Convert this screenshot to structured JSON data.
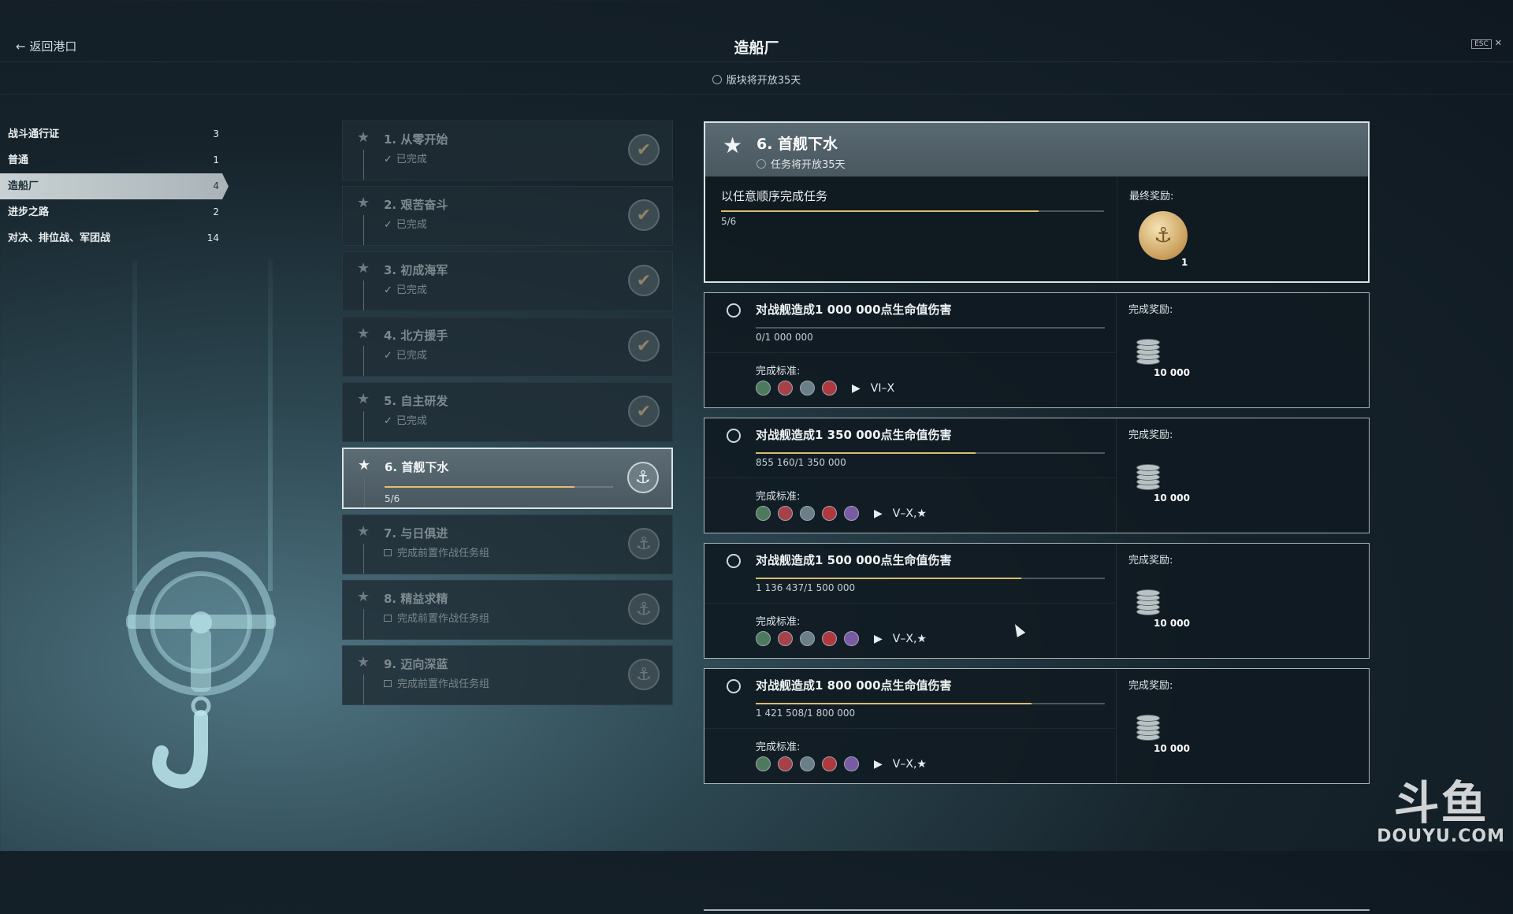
{
  "header": {
    "back_label": "← 返回港口",
    "title": "造船厂",
    "esc_key": "ESC",
    "close": "✕"
  },
  "subheader": {
    "timer": "版块将开放35天"
  },
  "sidebar": {
    "items": [
      {
        "label": "战斗通行证",
        "count": "3"
      },
      {
        "label": "普通",
        "count": "1"
      },
      {
        "label": "造船厂",
        "count": "4",
        "active": true
      },
      {
        "label": "进步之路",
        "count": "2"
      },
      {
        "label": "对决、排位战、军团战",
        "count": "14"
      }
    ]
  },
  "tasks": [
    {
      "name": "1. 从零开始",
      "status": "已完成",
      "state": "done"
    },
    {
      "name": "2. 艰苦奋斗",
      "status": "已完成",
      "state": "done"
    },
    {
      "name": "3. 初成海军",
      "status": "已完成",
      "state": "done"
    },
    {
      "name": "4. 北方援手",
      "status": "已完成",
      "state": "done"
    },
    {
      "name": "5. 自主研发",
      "status": "已完成",
      "state": "done"
    },
    {
      "name": "6. 首舰下水",
      "progress": "5/6",
      "progress_fraction": 0.833,
      "state": "active"
    },
    {
      "name": "7. 与日俱进",
      "status": "完成前置作战任务组",
      "state": "locked"
    },
    {
      "name": "8. 精益求精",
      "status": "完成前置作战任务组",
      "state": "locked"
    },
    {
      "name": "9. 迈向深蓝",
      "status": "完成前置作战任务组",
      "state": "locked"
    }
  ],
  "summary": {
    "title": "6. 首舰下水",
    "timer": "任务将开放35天",
    "desc": "以任意顺序完成任务",
    "progress": "5/6",
    "progress_fraction": 0.833,
    "final_reward_label": "最终奖励:",
    "final_reward_count": "1"
  },
  "missions": [
    {
      "title": "对战舰造成1 000 000点生命值伤害",
      "progress": "0/1 000 000",
      "fraction": 0.0,
      "criteria_label": "完成标准:",
      "tier": "VI–X",
      "classes": 4,
      "reward_label": "完成奖励:",
      "reward": "10 000"
    },
    {
      "title": "对战舰造成1 350 000点生命值伤害",
      "progress": "855 160/1 350 000",
      "fraction": 0.633,
      "criteria_label": "完成标准:",
      "tier": "V–X,★",
      "classes": 5,
      "reward_label": "完成奖励:",
      "reward": "10 000"
    },
    {
      "title": "对战舰造成1 500 000点生命值伤害",
      "progress": "1 136 437/1 500 000",
      "fraction": 0.758,
      "criteria_label": "完成标准:",
      "tier": "V–X,★",
      "classes": 5,
      "reward_label": "完成奖励:",
      "reward": "10 000"
    },
    {
      "title": "对战舰造成1 800 000点生命值伤害",
      "progress": "1 421 508/1 800 000",
      "fraction": 0.79,
      "criteria_label": "完成标准:",
      "tier": "V–X,★",
      "classes": 5,
      "reward_label": "完成奖励:",
      "reward": "10 000"
    }
  ],
  "watermark": {
    "logo": "斗鱼",
    "domain": "DOUYU.COM"
  },
  "colors": {
    "accent": "#d8bd6f",
    "active_bg": "#5c6c74"
  }
}
